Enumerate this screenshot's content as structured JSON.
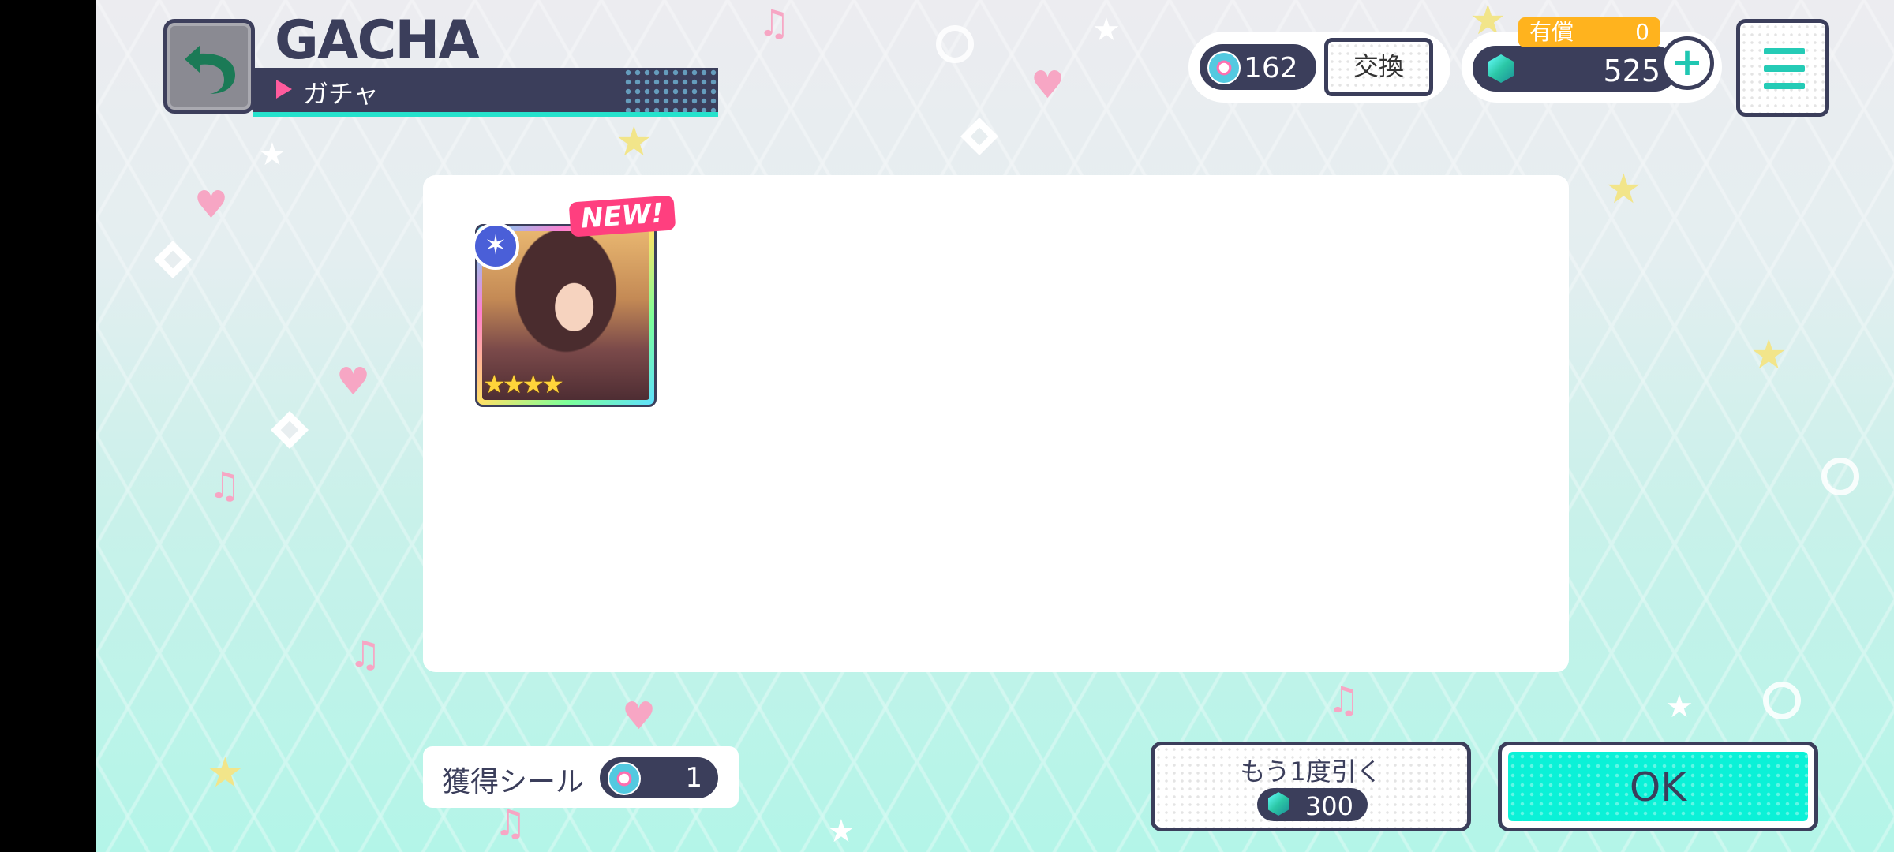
{
  "header": {
    "title": "GACHA",
    "subtitle": "ガチャ"
  },
  "currency": {
    "seals": "162",
    "exchange_label": "交換",
    "paid_label": "有償",
    "paid_value": "0",
    "gems": "525",
    "plus": "+"
  },
  "result": {
    "card": {
      "badge": "NEW!",
      "stars": "★★★★"
    }
  },
  "footer": {
    "seal_label": "獲得シール",
    "seal_count": "1",
    "again_label": "もう1度引く",
    "again_cost": "300",
    "ok_label": "OK"
  },
  "colors": {
    "navy": "#3b3e5b",
    "accent_teal": "#0bf1d7",
    "pink": "#ff3f7f",
    "gold": "#ffb31e"
  }
}
